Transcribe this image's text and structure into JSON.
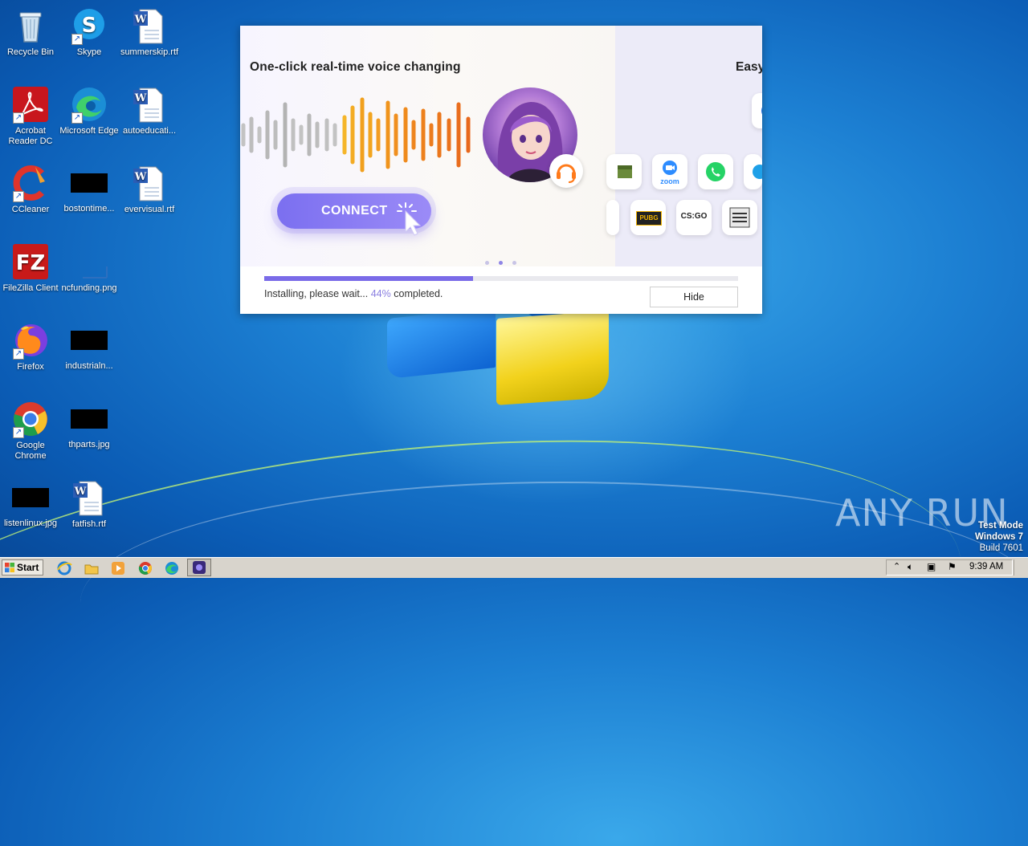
{
  "desktop": {
    "icons": [
      {
        "label": "Recycle Bin"
      },
      {
        "label": "Skype"
      },
      {
        "label": "summerskip.rtf"
      },
      {
        "label": "Acrobat Reader DC"
      },
      {
        "label": "Microsoft Edge"
      },
      {
        "label": "autoeducati..."
      },
      {
        "label": "CCleaner"
      },
      {
        "label": "bostontime..."
      },
      {
        "label": "evervisual.rtf"
      },
      {
        "label": "FileZilla Client"
      },
      {
        "label": "ncfunding.png"
      },
      {
        "label": "Firefox"
      },
      {
        "label": "industrialn..."
      },
      {
        "label": "Google Chrome"
      },
      {
        "label": "thparts.jpg"
      },
      {
        "label": "listenlinux.jpg"
      },
      {
        "label": "fatfish.rtf"
      }
    ]
  },
  "installer": {
    "headline": "One-click real-time voice changing",
    "headline_next": "Easy",
    "connect_label": "CONNECT",
    "app_icons": [
      "minecraft-icon",
      "zoom-icon",
      "whatsapp-icon",
      "skype-icon",
      "pubg-icon",
      "csgo-icon",
      "gta-icon"
    ],
    "zoom_text": "zoom",
    "pubg_text": "PUBG",
    "csgo_text": "CS:GO",
    "slide_dots": 3,
    "active_dot": 2,
    "progress": 44,
    "status_prefix": "Installing, please wait...",
    "status_percent": "44%",
    "status_suffix": "completed.",
    "hide_label": "Hide",
    "accent": "#7a6be8"
  },
  "watermark": {
    "text": "ANY RUN",
    "test_mode": "Test Mode",
    "os": "Windows 7",
    "build": "Build 7601"
  },
  "taskbar": {
    "start_label": "Start",
    "clock": "9:39 AM"
  }
}
